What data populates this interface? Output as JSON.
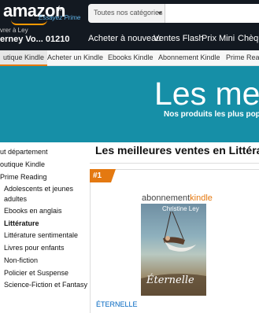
{
  "header": {
    "logo_text": "amazon",
    "logo_locale": ".fr",
    "logo_prime": "Essayez Prime",
    "search": {
      "category": "Toutes nos catégories",
      "placeholder": ""
    },
    "deliver_to": "vrer à Ley",
    "location": "erney Vo... 01210",
    "links": [
      "Acheter à nouveau",
      "Ventes Flash",
      "Prix Mini",
      "Chèque"
    ]
  },
  "subnav": {
    "items": [
      "utique Kindle",
      "Acheter un Kindle",
      "Ebooks Kindle",
      "Abonnement Kindle",
      "Prime Readi"
    ]
  },
  "banner": {
    "title": "Les mei",
    "subtitle": "Nos produits les plus popu"
  },
  "sidebar": {
    "items": [
      {
        "label": "ut département"
      },
      {
        "label": "outique Kindle"
      },
      {
        "label": "Prime Reading"
      },
      {
        "label": "Adolescents et jeunes"
      },
      {
        "label": "adultes"
      },
      {
        "label": "Ebooks en anglais"
      },
      {
        "label": "Littérature"
      },
      {
        "label": "Littérature sentimentale"
      },
      {
        "label": "Livres pour enfants"
      },
      {
        "label": "Non-fiction"
      },
      {
        "label": "Policier et Suspense"
      },
      {
        "label": "Science-Fiction et Fantasy"
      }
    ]
  },
  "main": {
    "title": "Les meilleures ventes en Littérat",
    "product": {
      "rank": "#1",
      "brand_prefix": "abonnement",
      "brand_suffix": "kindle",
      "cover_author": "Christine Ley",
      "cover_title": "Éternelle",
      "title": "ÉTERNELLE"
    }
  },
  "colors": {
    "nav_bg": "#131921",
    "accent": "#e47911",
    "banner_bg": "#168fa7",
    "link": "#0066c0"
  }
}
